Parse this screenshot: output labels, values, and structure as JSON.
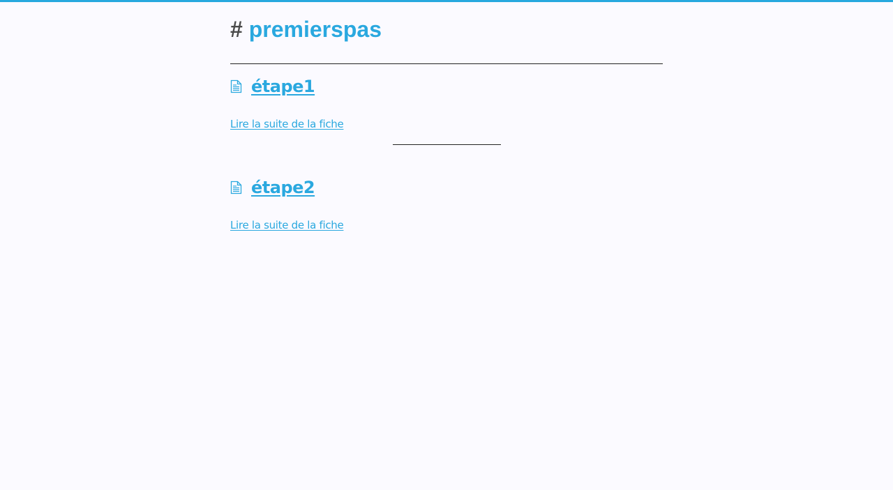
{
  "header": {
    "hash": "#",
    "tag": "premierspas"
  },
  "entries": [
    {
      "title": "étape1",
      "read_more": "Lire la suite de la fiche",
      "icon": "document-icon"
    },
    {
      "title": "étape2",
      "read_more": "Lire la suite de la fiche",
      "icon": "document-icon"
    }
  ],
  "colors": {
    "accent": "#2aa8df",
    "top_bar": "#27a8de",
    "hash": "#4a4a4a",
    "background": "#fbfaff"
  }
}
